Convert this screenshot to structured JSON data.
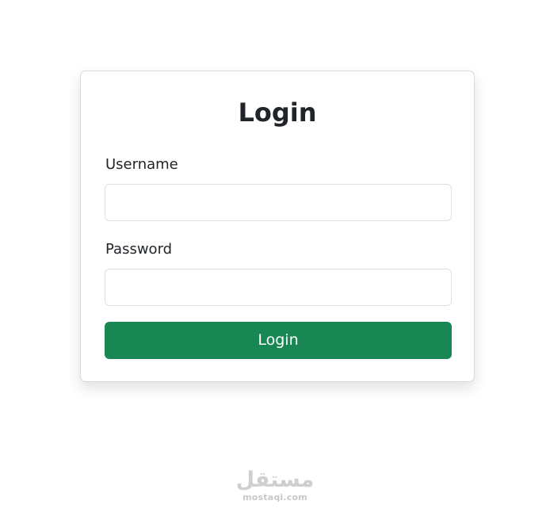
{
  "login_form": {
    "title": "Login",
    "username": {
      "label": "Username",
      "value": "",
      "placeholder": ""
    },
    "password": {
      "label": "Password",
      "value": "",
      "placeholder": ""
    },
    "submit_label": "Login",
    "colors": {
      "primary_button": "#198754",
      "button_text": "#ffffff",
      "text": "#212529",
      "input_border": "#dcdfe3",
      "background": "#ffffff"
    }
  },
  "watermark": {
    "logo_text": "مستقل",
    "url_text": "mostaqi.com"
  }
}
